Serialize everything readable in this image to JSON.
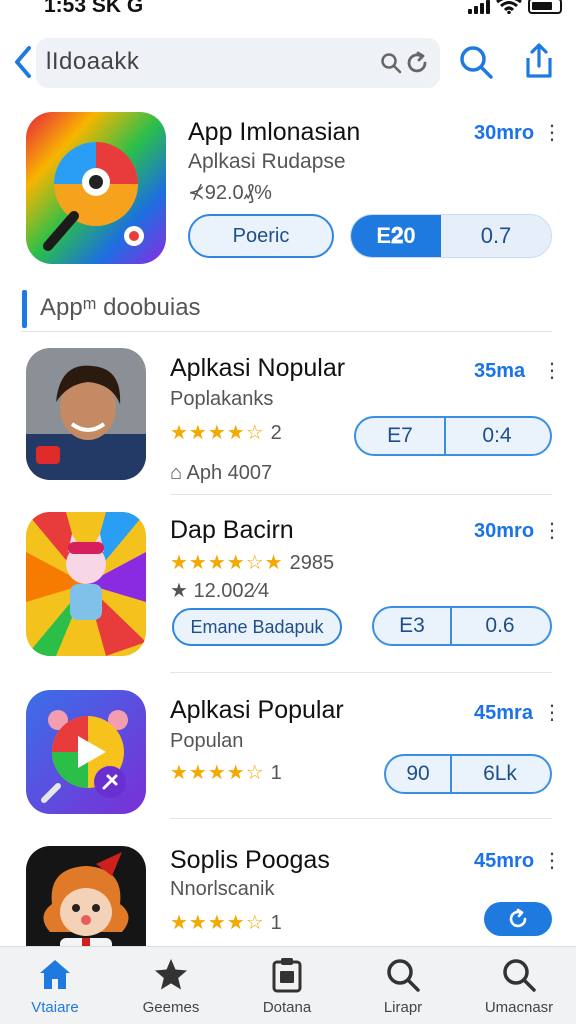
{
  "status_bar": {
    "time": "1:53 SK G"
  },
  "search": {
    "query": "lIdoaakk"
  },
  "featured": {
    "title": "App Imlonasian",
    "subtitle": "Aplkasi Rudapse",
    "meta": "⊀92.0₰%",
    "size": "30mro",
    "more": "⋮",
    "outline_button": "Poeric",
    "split_left": "E𝟐0",
    "split_right": "0.7"
  },
  "section": {
    "title": "Appᵐ doobuias"
  },
  "rows": [
    {
      "title": "Aplkasi Nopular",
      "subtitle": "Poplakanks",
      "stars": "★★★★☆",
      "count": "2",
      "meta": "⌂ Aph 4007",
      "size": "35ma",
      "more": "⋮",
      "pill_a": "E7",
      "pill_b": "0:4"
    },
    {
      "title": "Dap Bacirn",
      "subtitle": "",
      "stars": "★★★★☆★",
      "count": "2985",
      "meta": "★ 12.002⁄4",
      "size": "30mro",
      "more": "⋮",
      "outline_button": "Emane Badapuk",
      "pill_a": "E3",
      "pill_b": "0.6"
    },
    {
      "title": "Aplkasi Popular",
      "subtitle": "Populan",
      "stars": "★★★★☆",
      "count": "1",
      "size": "45mra",
      "more": "⋮",
      "pill_a": "90",
      "pill_b": "6Lk"
    },
    {
      "title": "Soplis Poogas",
      "subtitle": "Nnorlscanik",
      "stars": "★★★★☆",
      "count": "1",
      "size": "45mro",
      "more": "⋮"
    }
  ],
  "tabs": [
    {
      "label": "Vtaiare",
      "icon": "home-icon",
      "active": true
    },
    {
      "label": "Geemes",
      "icon": "star-icon",
      "active": false
    },
    {
      "label": "Dotana",
      "icon": "clipboard-icon",
      "active": false
    },
    {
      "label": "Lirapr",
      "icon": "search-icon",
      "active": false
    },
    {
      "label": "Umacnasr",
      "icon": "search-icon",
      "active": false
    }
  ],
  "colors": {
    "accent": "#1f7ae0",
    "star": "#f2a900",
    "tab_bg": "#f1f2f4"
  }
}
